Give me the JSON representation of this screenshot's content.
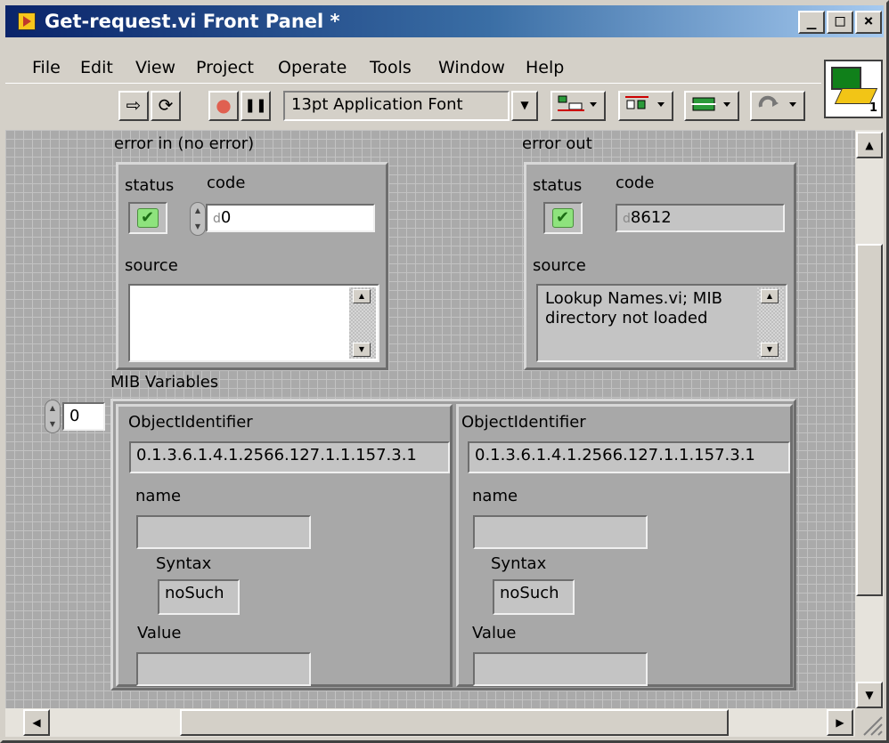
{
  "window": {
    "title": "Get-request.vi Front Panel *",
    "controls": {
      "minimize": "_",
      "maximize": "□",
      "close": "×"
    }
  },
  "menu": [
    "File",
    "Edit",
    "View",
    "Project",
    "Operate",
    "Tools",
    "Window",
    "Help"
  ],
  "toolbar": {
    "run_icon": "⇨",
    "run_continuous_icon": "⟳",
    "abort_icon": "●",
    "pause_icon": "❚❚",
    "font": "13pt Application Font",
    "dropdown_icon": "▼"
  },
  "vi_icon_number": "1",
  "error_in": {
    "label": "error in (no error)",
    "status_label": "status",
    "code_label": "code",
    "status_mark": "✔",
    "code_radix": "d",
    "code": "0",
    "source_label": "source",
    "source": ""
  },
  "error_out": {
    "label": "error out",
    "status_label": "status",
    "code_label": "code",
    "status_mark": "✔",
    "code_radix": "d",
    "code": "8612",
    "source_label": "source",
    "source": "Lookup Names.vi; MIB directory not loaded"
  },
  "mib": {
    "label": "MIB Variables",
    "index": "0",
    "elements": [
      {
        "oid_label": "ObjectIdentifier",
        "oid": "0.1.3.6.1.4.1.2566.127.1.1.157.3.1",
        "name_label": "name",
        "name": "",
        "syntax_label": "Syntax",
        "syntax": "noSuch",
        "value_label": "Value",
        "value": ""
      },
      {
        "oid_label": "ObjectIdentifier",
        "oid": "0.1.3.6.1.4.1.2566.127.1.1.157.3.1",
        "name_label": "name",
        "name": "",
        "syntax_label": "Syntax",
        "syntax": "noSuch",
        "value_label": "Value",
        "value": ""
      }
    ]
  },
  "scroll_arrows": {
    "up": "▲",
    "down": "▼",
    "left": "◀",
    "right": "▶"
  }
}
